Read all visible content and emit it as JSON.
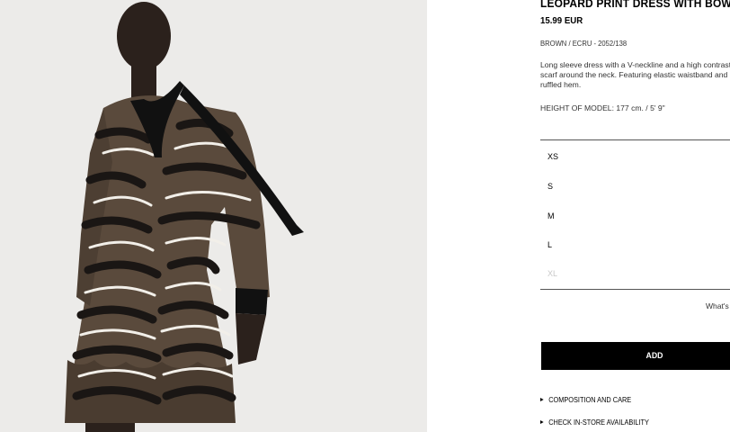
{
  "product": {
    "title": "LEOPARD PRINT DRESS WITH BOW",
    "price": "15.99 EUR",
    "color_ref": "BROWN / ECRU - 2052/138",
    "description": "Long sleeve dress with a V-neckline and a high contrast skinny scarf around the neck. Featuring elastic waistband and a ruffled hem.",
    "model_height": "HEIGHT OF MODEL: 177 cm. / 5' 9\""
  },
  "sizes": [
    {
      "label": "XS",
      "available": true
    },
    {
      "label": "S",
      "available": true
    },
    {
      "label": "M",
      "available": true
    },
    {
      "label": "L",
      "available": true
    },
    {
      "label": "XL",
      "available": false
    }
  ],
  "size_guide_link": "What's my size?",
  "add_button_label": "ADD",
  "links": {
    "composition": "COMPOSITION AND CARE",
    "store_availability": "CHECK IN-STORE AVAILABILITY"
  },
  "colors": {
    "photo_background": "#ecebe9",
    "dress_base": "#5a4a3c",
    "stripe_dark": "#1a1614",
    "stripe_light": "#f2efe9"
  }
}
